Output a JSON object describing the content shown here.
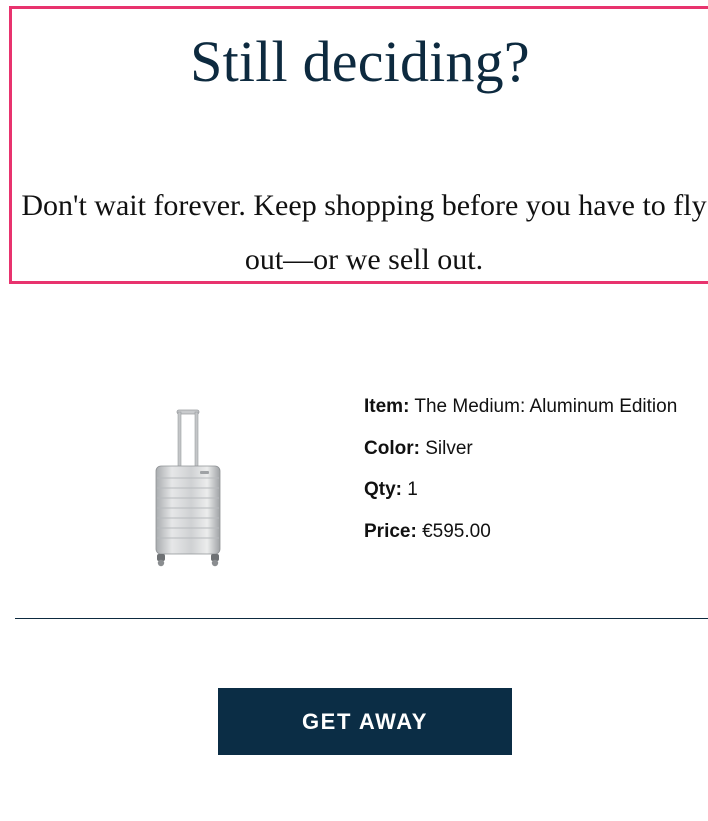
{
  "hero": {
    "title": "Still deciding?",
    "body": "Don't wait forever. Keep shopping before you have to fly out—or we sell out."
  },
  "product": {
    "image_icon": "suitcase-image",
    "item_label": "Item:",
    "item_value": "The Medium: Aluminum Edition",
    "color_label": "Color:",
    "color_value": "Silver",
    "qty_label": "Qty:",
    "qty_value": "1",
    "price_label": "Price:",
    "price_value": "€595.00"
  },
  "cta": {
    "label": "GET AWAY"
  },
  "colors": {
    "accent_border": "#e8336e",
    "navy": "#0b2d45"
  }
}
